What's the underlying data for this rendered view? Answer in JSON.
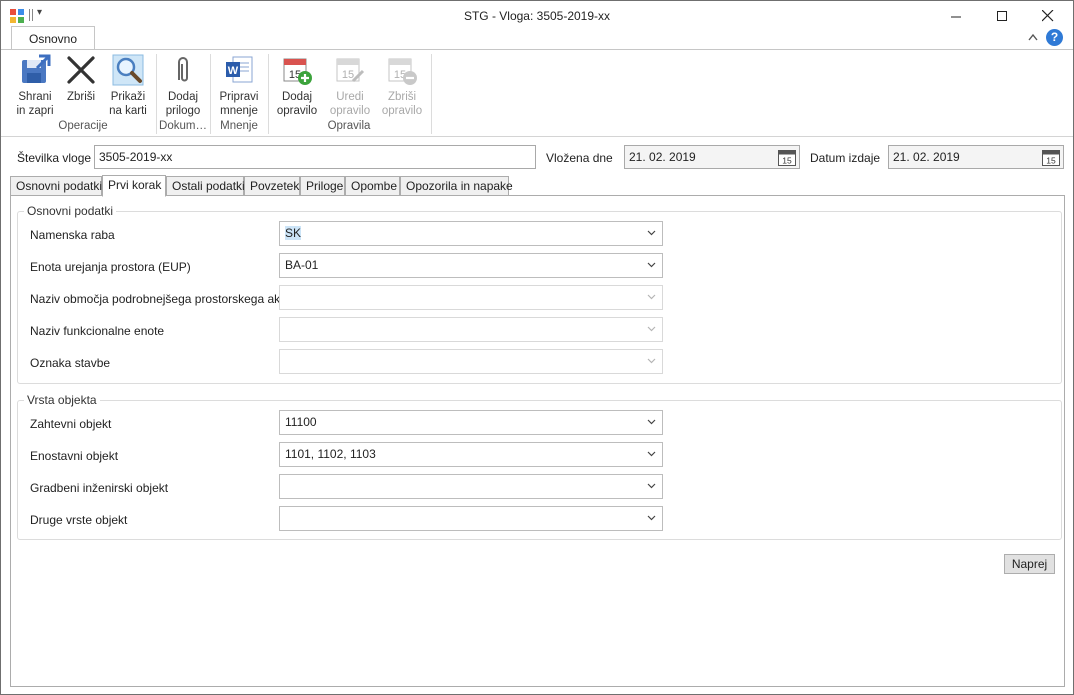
{
  "window": {
    "title": "STG - Vloga: 3505-2019-xx",
    "minimize_glyph": "—",
    "maximize_glyph": "☐",
    "close_glyph": "✕",
    "qat_dropdown_glyph": "▾"
  },
  "ribbon": {
    "tab_label": "Osnovno",
    "help_glyph": "?",
    "buttons": {
      "shrani": {
        "line1": "Shrani",
        "line2": "in zapri",
        "icon": "save-close-icon"
      },
      "zbrisi": {
        "line1": "Zbriši",
        "line2": "",
        "icon": "delete-x-icon"
      },
      "prikazi": {
        "line1": "Prikaži",
        "line2": "na karti",
        "icon": "magnifier-icon"
      },
      "dodaj_prilogo": {
        "line1": "Dodaj",
        "line2": "prilogo",
        "icon": "paperclip-icon"
      },
      "pripravi": {
        "line1": "Pripravi",
        "line2": "mnenje",
        "icon": "word-document-icon"
      },
      "dodaj_opravilo": {
        "line1": "Dodaj",
        "line2": "opravilo",
        "icon": "calendar-add-icon"
      },
      "uredi_opravilo": {
        "line1": "Uredi",
        "line2": "opravilo",
        "icon": "calendar-edit-icon"
      },
      "zbrisi_opravilo": {
        "line1": "Zbriši",
        "line2": "opravilo",
        "icon": "calendar-remove-icon"
      }
    },
    "groups": {
      "operacije": "Operacije",
      "dokumenti": "Dokum…",
      "mnenje": "Mnenje",
      "opravila": "Opravila"
    },
    "calendar_day": "15"
  },
  "header": {
    "stevilka_label": "Številka vloge",
    "stevilka_value": "3505-2019-xx",
    "vlozena_label": "Vložena dne",
    "vlozena_value": "21. 02. 2019",
    "izdaja_label": "Datum izdaje",
    "izdaja_value": "21. 02. 2019",
    "calendar_day": "15"
  },
  "tabs": [
    {
      "label": "Osnovni podatki"
    },
    {
      "label": "Prvi korak"
    },
    {
      "label": "Ostali podatki"
    },
    {
      "label": "Povzetek"
    },
    {
      "label": "Priloge"
    },
    {
      "label": "Opombe"
    },
    {
      "label": "Opozorila in napake"
    }
  ],
  "osnovni": {
    "title": "Osnovni podatki",
    "fields": [
      {
        "label": "Namenska raba",
        "value": "SK"
      },
      {
        "label": "Enota urejanja prostora (EUP)",
        "value": "BA-01"
      },
      {
        "label": "Naziv območja podrobnejšega prostorskega akta",
        "value": ""
      },
      {
        "label": "Naziv funkcionalne enote",
        "value": ""
      },
      {
        "label": "Oznaka stavbe",
        "value": ""
      }
    ]
  },
  "vrsta": {
    "title": "Vrsta objekta",
    "fields": [
      {
        "label": "Zahtevni objekt",
        "value": "11100"
      },
      {
        "label": "Enostavni objekt",
        "value": "1101, 1102, 1103"
      },
      {
        "label": "Gradbeni inženirski objekt",
        "value": ""
      },
      {
        "label": "Druge vrste objekt",
        "value": ""
      }
    ]
  },
  "actions": {
    "naprej": "Naprej"
  }
}
